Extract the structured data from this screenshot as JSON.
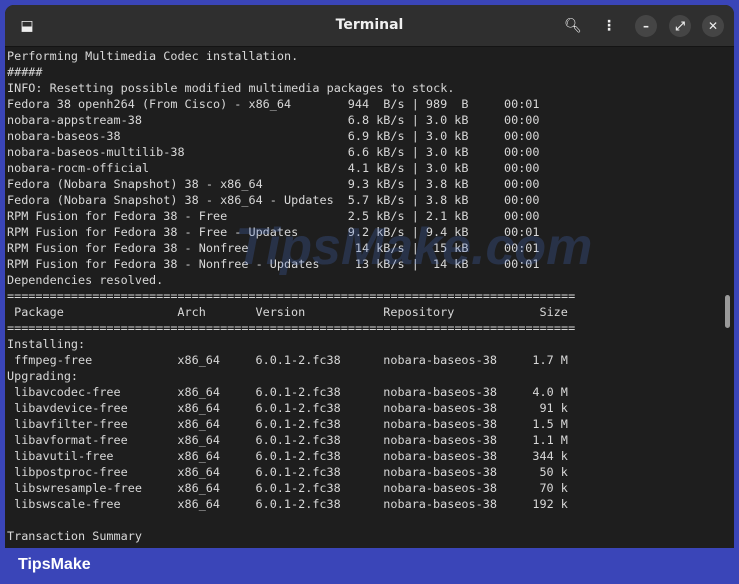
{
  "window": {
    "title": "Terminal"
  },
  "icons": {
    "new_tab": "new-tab-icon",
    "search": "search-icon",
    "menu": "kebab-menu-icon",
    "minimize": "minimize-icon",
    "maximize": "maximize-icon",
    "close": "close-icon"
  },
  "terminal": {
    "intro": [
      "Performing Multimedia Codec installation.",
      "#####",
      "INFO: Resetting possible modified multimedia packages to stock."
    ],
    "downloads": [
      {
        "name": "Fedora 38 openh264 (From Cisco) - x86_64",
        "speed": "944  B/s",
        "size": "989  B",
        "time": "00:01"
      },
      {
        "name": "nobara-appstream-38",
        "speed": "6.8 kB/s",
        "size": "3.0 kB",
        "time": "00:00"
      },
      {
        "name": "nobara-baseos-38",
        "speed": "6.9 kB/s",
        "size": "3.0 kB",
        "time": "00:00"
      },
      {
        "name": "nobara-baseos-multilib-38",
        "speed": "6.6 kB/s",
        "size": "3.0 kB",
        "time": "00:00"
      },
      {
        "name": "nobara-rocm-official",
        "speed": "4.1 kB/s",
        "size": "3.0 kB",
        "time": "00:00"
      },
      {
        "name": "Fedora (Nobara Snapshot) 38 - x86_64",
        "speed": "9.3 kB/s",
        "size": "3.8 kB",
        "time": "00:00"
      },
      {
        "name": "Fedora (Nobara Snapshot) 38 - x86_64 - Updates",
        "speed": "5.7 kB/s",
        "size": "3.8 kB",
        "time": "00:00"
      },
      {
        "name": "RPM Fusion for Fedora 38 - Free",
        "speed": "2.5 kB/s",
        "size": "2.1 kB",
        "time": "00:00"
      },
      {
        "name": "RPM Fusion for Fedora 38 - Free - Updates",
        "speed": "9.2 kB/s",
        "size": "9.4 kB",
        "time": "00:01"
      },
      {
        "name": "RPM Fusion for Fedora 38 - Nonfree",
        "speed": " 14 kB/s",
        "size": " 15 kB",
        "time": "00:01"
      },
      {
        "name": "RPM Fusion for Fedora 38 - Nonfree - Updates",
        "speed": " 13 kB/s",
        "size": " 14 kB",
        "time": "00:01"
      }
    ],
    "resolved": "Dependencies resolved.",
    "separator": "================================================================================",
    "columns": {
      "package": "Package",
      "arch": "Arch",
      "version": "Version",
      "repository": "Repository",
      "size": "Size"
    },
    "installing_label": "Installing:",
    "installing": [
      {
        "package": "ffmpeg-free",
        "arch": "x86_64",
        "version": "6.0.1-2.fc38",
        "repository": "nobara-baseos-38",
        "size": "1.7 M"
      }
    ],
    "upgrading_label": "Upgrading:",
    "upgrading": [
      {
        "package": "libavcodec-free",
        "arch": "x86_64",
        "version": "6.0.1-2.fc38",
        "repository": "nobara-baseos-38",
        "size": "4.0 M"
      },
      {
        "package": "libavdevice-free",
        "arch": "x86_64",
        "version": "6.0.1-2.fc38",
        "repository": "nobara-baseos-38",
        "size": "91 k"
      },
      {
        "package": "libavfilter-free",
        "arch": "x86_64",
        "version": "6.0.1-2.fc38",
        "repository": "nobara-baseos-38",
        "size": "1.5 M"
      },
      {
        "package": "libavformat-free",
        "arch": "x86_64",
        "version": "6.0.1-2.fc38",
        "repository": "nobara-baseos-38",
        "size": "1.1 M"
      },
      {
        "package": "libavutil-free",
        "arch": "x86_64",
        "version": "6.0.1-2.fc38",
        "repository": "nobara-baseos-38",
        "size": "344 k"
      },
      {
        "package": "libpostproc-free",
        "arch": "x86_64",
        "version": "6.0.1-2.fc38",
        "repository": "nobara-baseos-38",
        "size": "50 k"
      },
      {
        "package": "libswresample-free",
        "arch": "x86_64",
        "version": "6.0.1-2.fc38",
        "repository": "nobara-baseos-38",
        "size": "70 k"
      },
      {
        "package": "libswscale-free",
        "arch": "x86_64",
        "version": "6.0.1-2.fc38",
        "repository": "nobara-baseos-38",
        "size": "192 k"
      }
    ],
    "summary": "Transaction Summary"
  },
  "watermark": "TipsMake.com",
  "footer": {
    "brand": "TipsMake"
  }
}
